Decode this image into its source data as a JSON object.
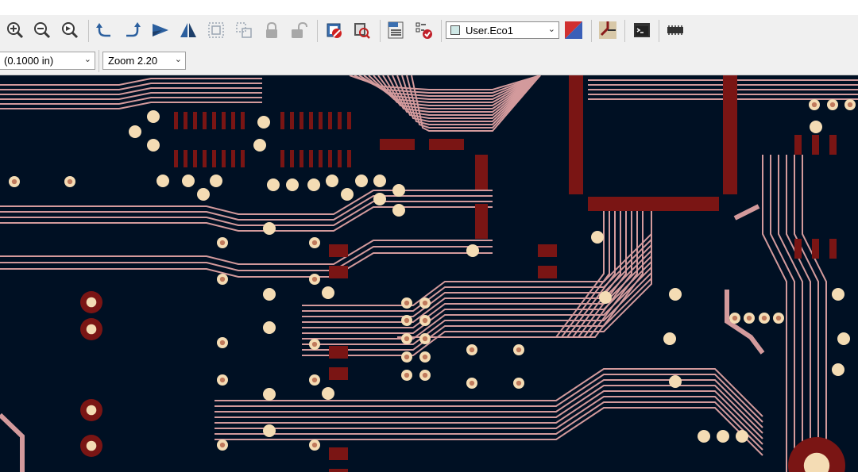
{
  "toolbar": {
    "icons": [
      {
        "name": "zoom-in-icon"
      },
      {
        "name": "zoom-out-icon"
      },
      {
        "name": "zoom-fit-icon"
      },
      {
        "name": "rotate-ccw-icon"
      },
      {
        "name": "rotate-cw-icon"
      },
      {
        "name": "flip-horizontal-icon"
      },
      {
        "name": "mirror-icon"
      },
      {
        "name": "group-icon"
      },
      {
        "name": "ungroup-icon"
      },
      {
        "name": "lock-icon"
      },
      {
        "name": "unlock-icon"
      },
      {
        "name": "drc-icon"
      },
      {
        "name": "inspect-icon"
      },
      {
        "name": "netlist-icon"
      },
      {
        "name": "checklist-icon"
      },
      {
        "name": "layer-pair-icon"
      },
      {
        "name": "route-icon"
      },
      {
        "name": "scripting-console-icon"
      },
      {
        "name": "footprint-icon"
      }
    ],
    "layer": {
      "value": "User.Eco1",
      "swatch_color": "#cfe8e6"
    }
  },
  "toolbar2": {
    "grid": {
      "value": "(0.1000 in)"
    },
    "zoom": {
      "value": "Zoom 2.20"
    }
  },
  "canvas": {
    "colors": {
      "background": "#001023",
      "track": "#d39a9c",
      "pad": "#7a1514",
      "via_ring": "#f4dcb4",
      "via_hole": "#c07a5c"
    }
  }
}
